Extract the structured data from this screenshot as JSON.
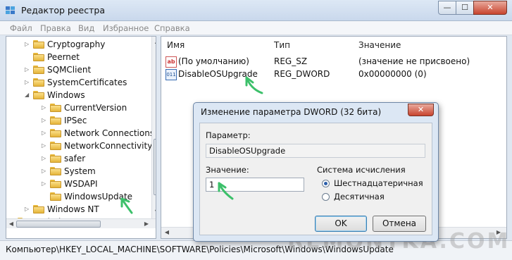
{
  "window": {
    "title": "Редактор реестра",
    "minimize_glyph": "—",
    "maximize_glyph": "☐",
    "close_glyph": "✕"
  },
  "menu": [
    "Файл",
    "Правка",
    "Вид",
    "Избранное",
    "Справка"
  ],
  "tree": {
    "items": [
      {
        "label": "Cryptography",
        "level": 1,
        "expander": "collapsed"
      },
      {
        "label": "Peernet",
        "level": 1,
        "expander": "none"
      },
      {
        "label": "SQMClient",
        "level": 1,
        "expander": "collapsed"
      },
      {
        "label": "SystemCertificates",
        "level": 1,
        "expander": "collapsed"
      },
      {
        "label": "Windows",
        "level": 1,
        "expander": "expanded"
      },
      {
        "label": "CurrentVersion",
        "level": 2,
        "expander": "collapsed"
      },
      {
        "label": "IPSec",
        "level": 2,
        "expander": "collapsed"
      },
      {
        "label": "Network Connections",
        "level": 2,
        "expander": "collapsed"
      },
      {
        "label": "NetworkConnectivityS",
        "level": 2,
        "expander": "collapsed"
      },
      {
        "label": "safer",
        "level": 2,
        "expander": "collapsed"
      },
      {
        "label": "System",
        "level": 2,
        "expander": "collapsed"
      },
      {
        "label": "WSDAPI",
        "level": 2,
        "expander": "collapsed"
      },
      {
        "label": "WindowsUpdate",
        "level": 2,
        "expander": "none"
      },
      {
        "label": "Windows NT",
        "level": 1,
        "expander": "collapsed"
      },
      {
        "label": "Realtek",
        "level": 0,
        "expander": "collapsed"
      }
    ]
  },
  "values": {
    "columns": {
      "name": "Имя",
      "type": "Тип",
      "value": "Значение"
    },
    "rows": [
      {
        "icon": "ab",
        "name": "(По умолчанию)",
        "type": "REG_SZ",
        "value": "(значение не присвоено)"
      },
      {
        "icon": "011",
        "name": "DisableOSUpgrade",
        "type": "REG_DWORD",
        "value": "0x00000000 (0)"
      }
    ]
  },
  "dialog": {
    "title": "Изменение параметра DWORD (32 бита)",
    "param_label": "Параметр:",
    "param_value": "DisableOSUpgrade",
    "value_label": "Значение:",
    "value_input": "1",
    "base_label": "Система исчисления",
    "radio_hex": "Шестнадцатеричная",
    "radio_dec": "Десятичная",
    "selected_base": "hex",
    "ok": "OK",
    "cancel": "Отмена"
  },
  "status": "Компьютер\\HKEY_LOCAL_MACHINE\\SOFTWARE\\Policies\\Microsoft\\Windows\\WindowsUpdate",
  "watermark": "REMONTKA.COM",
  "colors": {
    "accent_arrow": "#3cc06a",
    "title_bar": "#c9d8ec",
    "close_red": "#c8442f"
  }
}
